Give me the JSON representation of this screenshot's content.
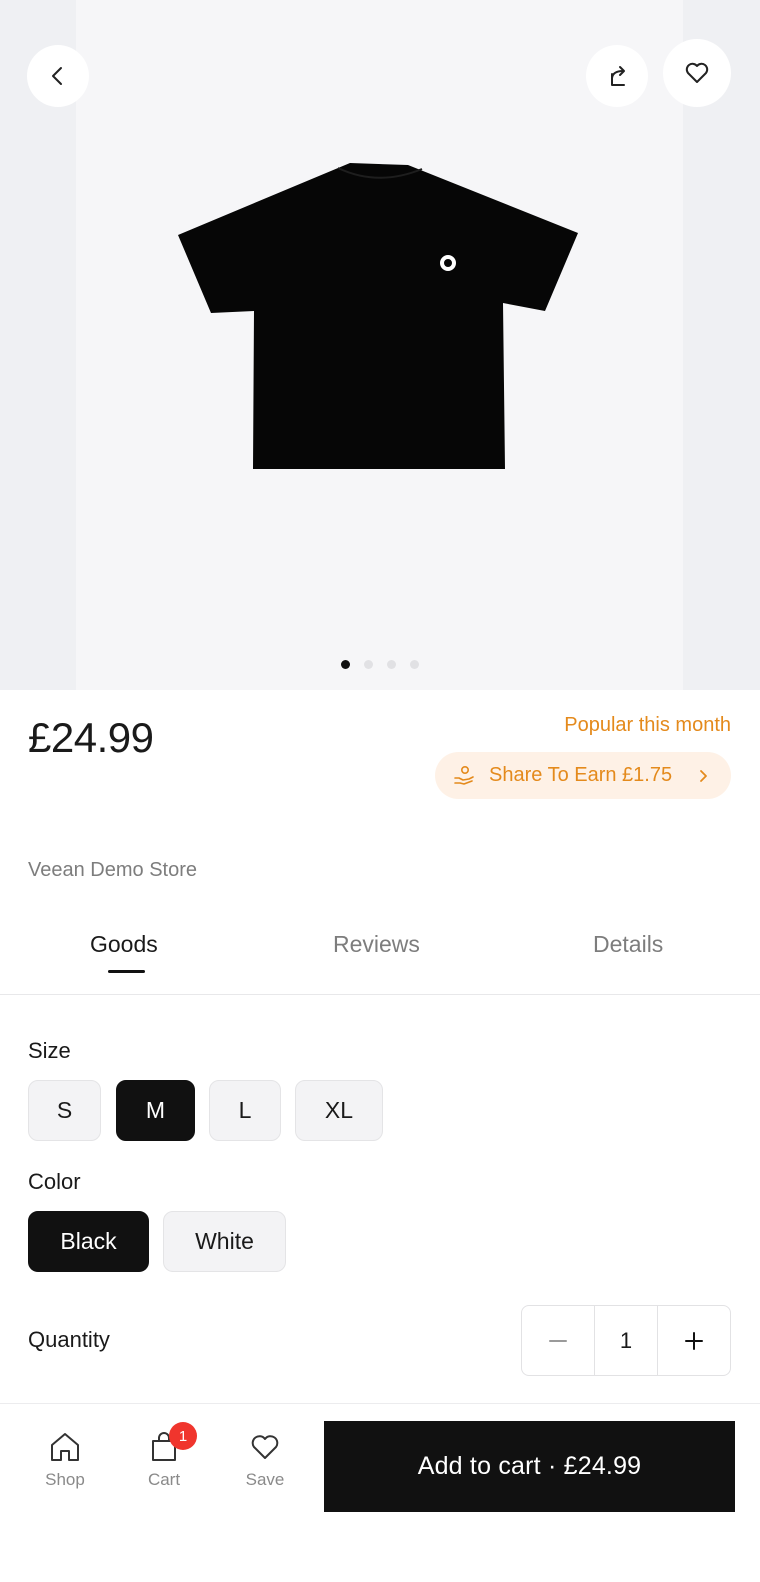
{
  "header": {
    "back_icon": "chevron-left-icon",
    "share_icon": "share-icon",
    "favorite_icon": "heart-icon"
  },
  "gallery": {
    "image": "black-tshirt",
    "dot_count": 4,
    "active_index": 0
  },
  "product": {
    "price": "£24.99",
    "popular_label": "Popular this month",
    "share_to_earn": "Share To Earn £1.75",
    "store_name": "Veean Demo Store"
  },
  "tabs": [
    {
      "label": "Goods",
      "active": true
    },
    {
      "label": "Reviews",
      "active": false
    },
    {
      "label": "Details",
      "active": false
    }
  ],
  "options": {
    "size_title": "Size",
    "sizes": [
      "S",
      "M",
      "L",
      "XL"
    ],
    "selected_size": "M",
    "color_title": "Color",
    "colors": [
      "Black",
      "White"
    ],
    "selected_color": "Black",
    "quantity_label": "Quantity",
    "quantity": "1",
    "minus": "−",
    "plus": "+"
  },
  "bottom_nav": {
    "shop_label": "Shop",
    "cart_label": "Cart",
    "cart_badge": "1",
    "save_label": "Save",
    "add_to_cart": "Add to cart · £24.99"
  },
  "colors": {
    "accent": "#e48a1c",
    "accent_bg": "#fef1e6",
    "primary": "#111111",
    "badge": "#f0352d"
  }
}
